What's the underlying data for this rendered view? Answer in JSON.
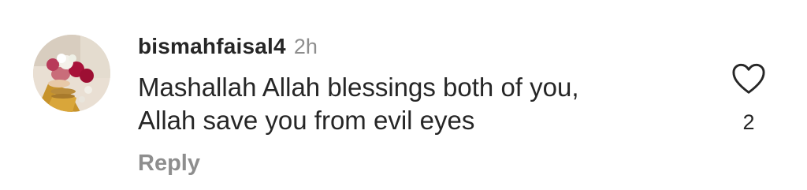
{
  "comment": {
    "username": "bismahfaisal4",
    "time": "2h",
    "text_lines": [
      "Mashallah Allah blessings both of you,",
      "Allah save you from evil eyes"
    ],
    "reply_label": "Reply",
    "like_count": "2",
    "like_icon": "heart-outline-icon"
  },
  "colors": {
    "text": "#262626",
    "secondary": "#8e8e8e",
    "background": "#ffffff"
  }
}
